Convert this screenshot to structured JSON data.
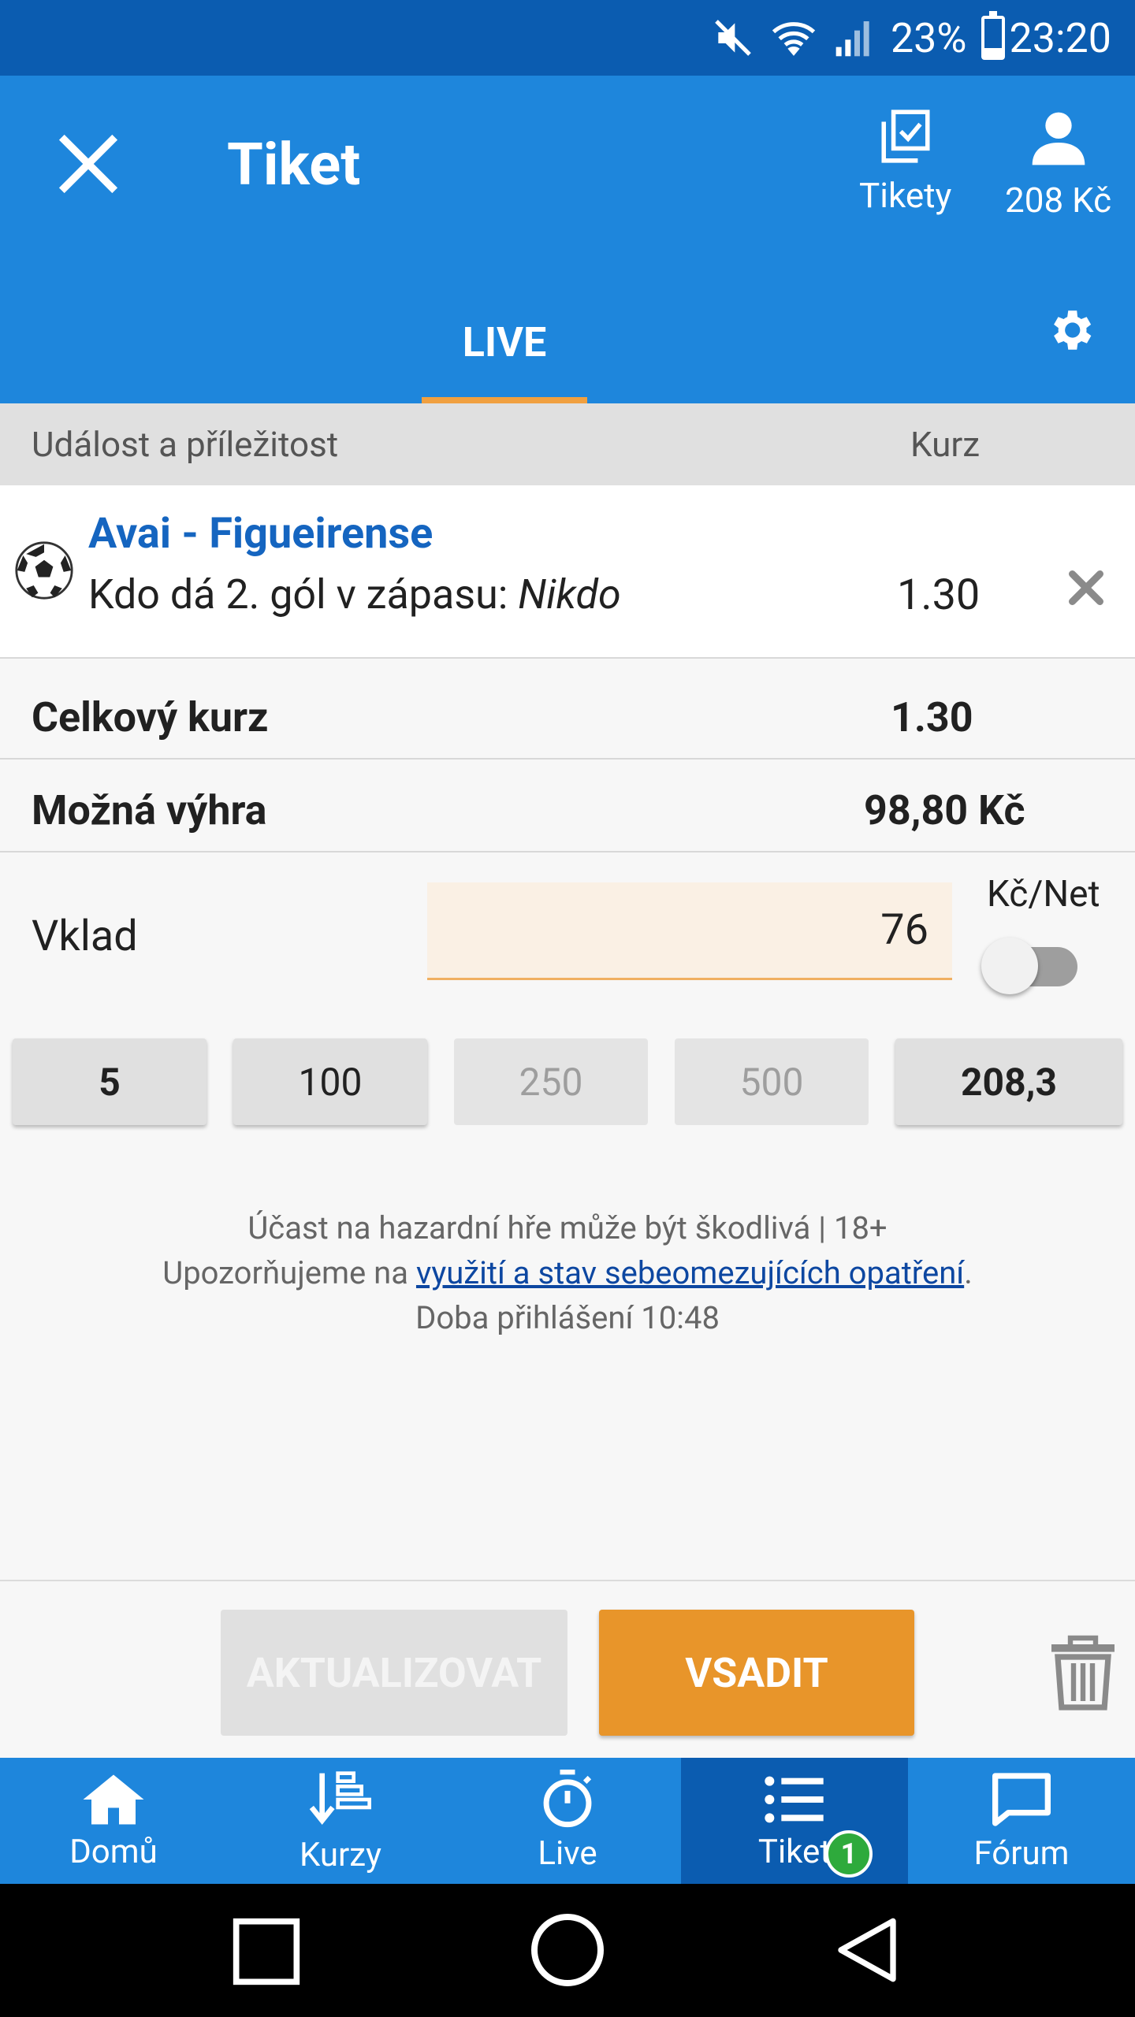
{
  "status_bar": {
    "battery": "23%",
    "time": "23:20"
  },
  "header": {
    "title": "Tiket",
    "tickets_label": "Tikety",
    "balance": "208 Kč",
    "tab": "LIVE"
  },
  "table": {
    "col_event": "Událost a příležitost",
    "col_odds": "Kurz"
  },
  "bet": {
    "match": "Avai - Figueirense",
    "market": "Kdo dá 2. gól v zápasu: ",
    "selection": "Nikdo",
    "odds": "1.30"
  },
  "summary": {
    "total_label": "Celkový kurz",
    "total_value": "1.30",
    "win_label": "Možná výhra",
    "win_value": "98,80 Kč"
  },
  "stake": {
    "label": "Vklad",
    "value": "76",
    "unit_label": "Kč/Net",
    "toggle_on": false
  },
  "quick_amounts": [
    "5",
    "100",
    "250",
    "500",
    "208,3"
  ],
  "info": {
    "line1": "Účast na hazardní hře může být škodlivá | 18+",
    "line2_prefix": "Upozorňujeme na ",
    "line2_link": "využití a stav sebeomezujících opatření",
    "line2_suffix": ".",
    "line3": "Doba přihlášení 10:48"
  },
  "actions": {
    "update": "AKTUALIZOVAT",
    "bet": "VSADIT"
  },
  "nav": {
    "items": [
      {
        "label": "Domů",
        "icon": "home-icon"
      },
      {
        "label": "Kurzy",
        "icon": "odds-icon"
      },
      {
        "label": "Live",
        "icon": "stopwatch-icon"
      },
      {
        "label": "Tiket",
        "icon": "list-icon"
      },
      {
        "label": "Fórum",
        "icon": "chat-icon"
      }
    ],
    "active": "Tiket",
    "badge": "1"
  },
  "colors": {
    "primary": "#1e86dc",
    "primary_dark": "#0b5cb0",
    "accent": "#e8952a",
    "badge": "#2eaa3c"
  }
}
